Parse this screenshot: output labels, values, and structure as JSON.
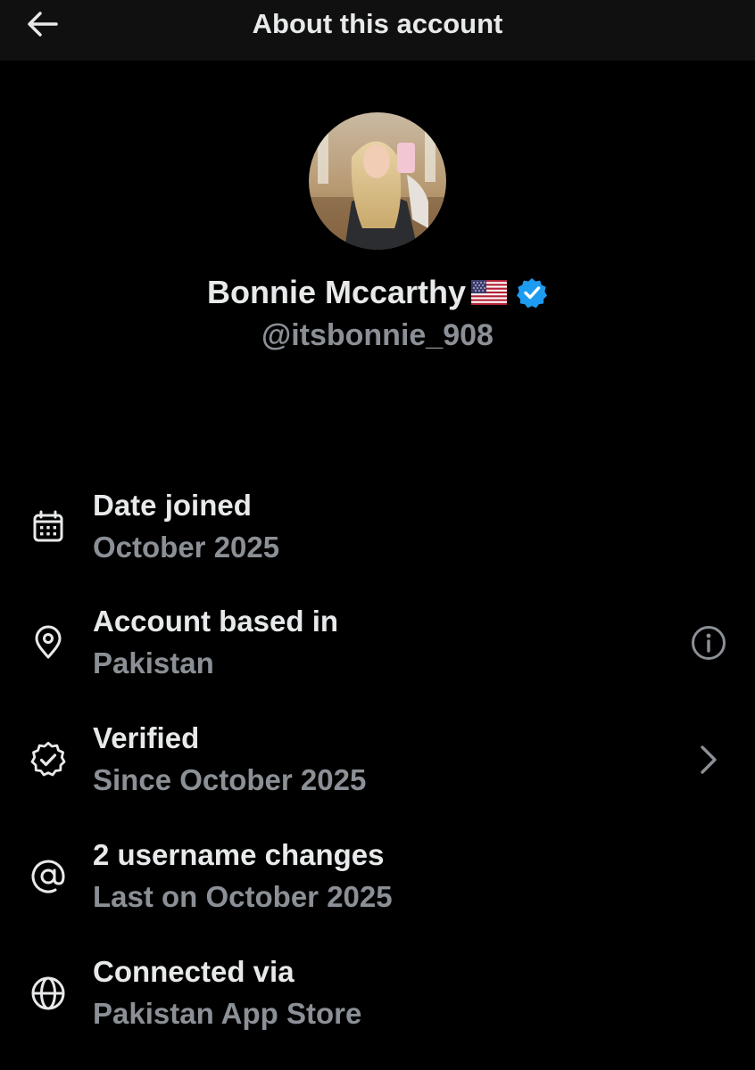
{
  "header": {
    "title": "About this account",
    "back_icon": "arrow-left-icon"
  },
  "profile": {
    "display_name": "Bonnie Mccarthy",
    "flag": "🇺🇸",
    "flag_icon": "us-flag-icon",
    "verified_icon": "verified-badge-icon",
    "verified_color": "#1d9bf0",
    "handle": "@itsbonnie_908"
  },
  "rows": [
    {
      "title": "Date joined",
      "subtitle": "October 2025",
      "icon": "calendar-icon"
    },
    {
      "title": "Account based in",
      "subtitle": "Pakistan",
      "icon": "location-pin-icon",
      "action_icon": "info-icon"
    },
    {
      "title": "Verified",
      "subtitle": "Since October 2025",
      "icon": "verified-outline-icon",
      "action_icon": "chevron-right-icon"
    },
    {
      "title": "2 username changes",
      "subtitle": "Last on October 2025",
      "icon": "at-sign-icon"
    },
    {
      "title": "Connected via",
      "subtitle": "Pakistan App Store",
      "icon": "globe-icon"
    }
  ],
  "colors": {
    "background": "#000000",
    "header_background": "#101010",
    "primary_text": "#e7e9ea",
    "secondary_text": "#8b9096"
  }
}
